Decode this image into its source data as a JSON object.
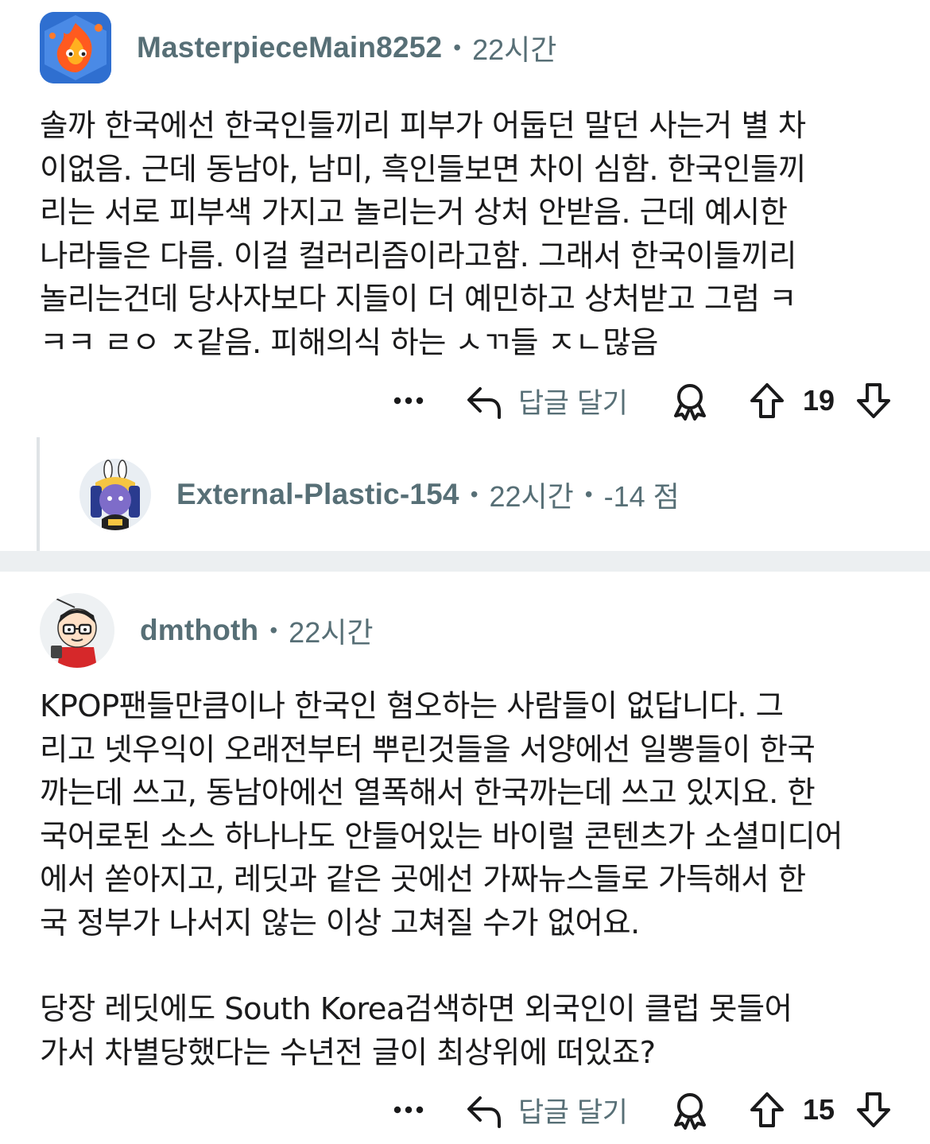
{
  "comments": [
    {
      "username": "MasterpieceMain8252",
      "time": "22시간",
      "body": [
        "솔까 한국에선 한국인들끼리 피부가 어둡던 말던 사는거 별 차\n이없음. 근데 동남아, 남미, 흑인들보면 차이 심함. 한국인들끼\n리는 서로 피부색 가지고 놀리는거 상처 안받음. 근데 예시한\n나라들은 다름. 이걸 컬러리즘이라고함. 그래서 한국이들끼리\n놀리는건데 당사자보다 지들이 더 예민하고 상처받고 그럼 ㅋ\nㅋㅋ ㄹㅇ ㅈ같음. 피해의식 하는 ㅅㄲ들 ㅈㄴ많음"
      ],
      "reply_label": "답글 달기",
      "votes": "19"
    },
    {
      "username": "External-Plastic-154",
      "time": "22시간",
      "score": "-14 점"
    },
    {
      "username": "dmthoth",
      "time": "22시간",
      "body": [
        "KPOP팬들만큼이나 한국인 혐오하는 사람들이 없답니다. 그\n리고 넷우익이 오래전부터 뿌린것들을 서양에선 일뽕들이 한국\n까는데 쓰고, 동남아에선 열폭해서 한국까는데 쓰고 있지요. 한\n국어로된 소스 하나나도 안들어있는 바이럴 콘텐츠가 소셜미디어\n에서 쏟아지고, 레딧과 같은 곳에선 가짜뉴스들로 가득해서 한\n국 정부가 나서지 않는 이상 고쳐질 수가 없어요.",
        "당장 레딧에도 South Korea검색하면 외국인이 클럽 못들어\n가서 차별당했다는 수년전 글이 최상위에 떠있죠?"
      ],
      "reply_label": "답글 달기",
      "votes": "15"
    }
  ],
  "icons": [
    "more-icon",
    "reply-icon",
    "award-icon",
    "upvote-icon",
    "downvote-icon"
  ],
  "colors": {
    "meta_gray": "#576f76",
    "text": "#1a1a1b",
    "divider": "#eceff1"
  }
}
